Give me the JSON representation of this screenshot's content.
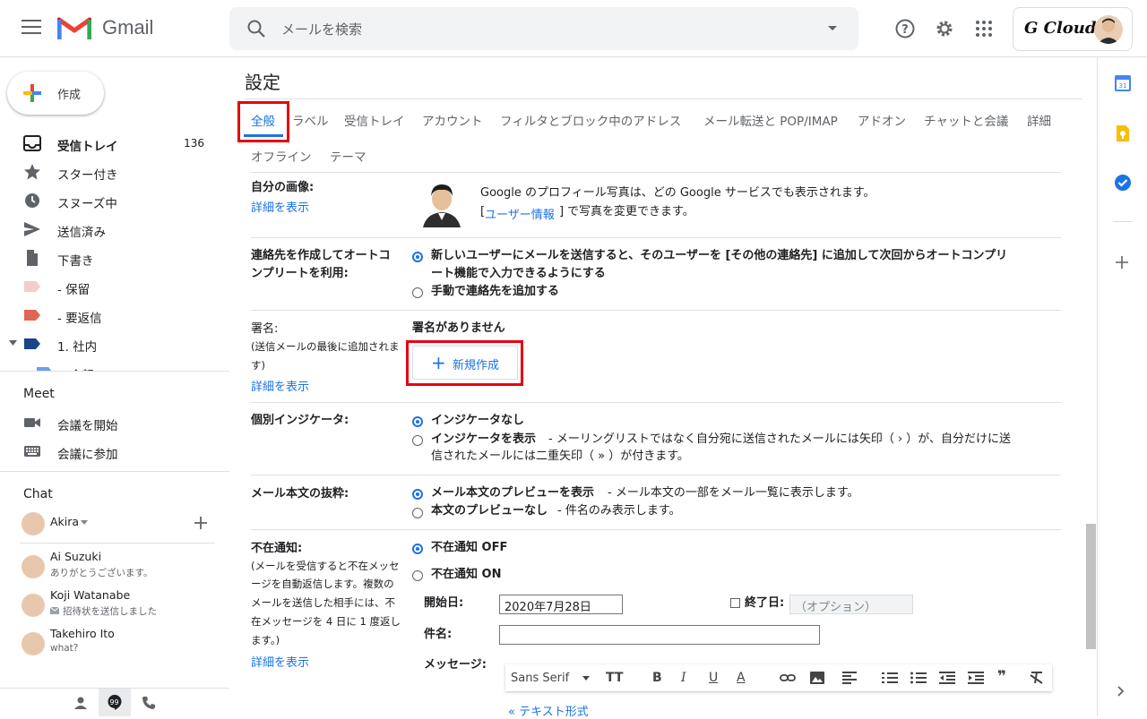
{
  "header": {
    "app_name": "Gmail",
    "search_placeholder": "メールを検索",
    "account_brand": "G Cloud"
  },
  "sidebar": {
    "compose_label": "作成",
    "items": [
      {
        "label": "受信トレイ",
        "count": "136"
      },
      {
        "label": "スター付き"
      },
      {
        "label": "スヌーズ中"
      },
      {
        "label": "送信済み"
      },
      {
        "label": "下書き"
      },
      {
        "label": "- 保留"
      },
      {
        "label": "- 要返信"
      },
      {
        "label": "1. 社内"
      },
      {
        "label": "会報"
      }
    ],
    "label_colors": [
      "#f4cccc",
      "#e06655",
      "#1c4587",
      "#6d9eeb"
    ],
    "meet_title": "Meet",
    "meet_items": [
      "会議を開始",
      "会議に参加"
    ],
    "chat_title": "Chat",
    "chat_self": "Akira",
    "chats": [
      {
        "name": "Ai Suzuki",
        "status": "ありがとうございます。"
      },
      {
        "name": "Koji Watanabe",
        "status": "招待状を送信しました"
      },
      {
        "name": "Takehiro Ito",
        "status": "what?"
      }
    ]
  },
  "settings": {
    "title": "設定",
    "tabs": [
      "全般",
      "ラベル",
      "受信トレイ",
      "アカウント",
      "フィルタとブロック中のアドレス",
      "メール転送と POP/IMAP",
      "アドオン",
      "チャットと会議",
      "詳細",
      "オフライン",
      "テーマ"
    ],
    "my_picture": {
      "label": "自分の画像:",
      "link": "詳細を表示",
      "desc1": "Google のプロフィール写真は、どの Google サービスでも表示されます。",
      "desc2_link": "ユーザー情報",
      "desc2_rest": "で写真を変更できます。",
      "bracket_open": "[",
      "bracket_close": "]"
    },
    "autocomplete": {
      "label1": "連絡先を作成してオートコ",
      "label2": "ンプリートを利用:",
      "opt1_line1": "新しいユーザーにメールを送信すると、そのユーザーを [その他の連絡先] に追加して次回からオートコンプリ",
      "opt1_line2": "ート機能で入力できるようにする",
      "opt2": "手動で連絡先を追加する"
    },
    "signature": {
      "label": "署名:",
      "sub1": "(送信メールの最後に追加されま",
      "sub2": "す)",
      "link": "詳細を表示",
      "none": "署名がありません",
      "new_button": "新規作成"
    },
    "indicators": {
      "label": "個別インジケータ:",
      "opt1": "インジケータなし",
      "opt2_bold": "インジケータを表示",
      "opt2_rest": " - メーリングリストではなく自分宛に送信されたメールには矢印（ › ）が、自分だけに送",
      "opt2_line2": "信されたメールには二重矢印（ » ）が付きます。"
    },
    "snippets": {
      "label": "メール本文の抜粋:",
      "opt1_bold": "メール本文のプレビューを表示",
      "opt1_rest": " - メール本文の一部をメール一覧に表示します。",
      "opt2_bold": "本文のプレビューなし",
      "opt2_rest": " - 件名のみ表示します。"
    },
    "vacation": {
      "label": "不在通知:",
      "sub": [
        "(メールを受信すると不在メッセ",
        "ージを自動返信します。複数の",
        "メールを送信した相手には、不",
        "在メッセージを 4 日に 1 度返し",
        "ます。)"
      ],
      "link": "詳細を表示",
      "off": "不在通知 OFF",
      "on": "不在通知 ON",
      "start_label": "開始日:",
      "start_value": "2020年7月28日",
      "end_label": "終了日:",
      "end_placeholder": "（オプション）",
      "subject_label": "件名:",
      "message_label": "メッセージ:",
      "font": "Sans Serif",
      "plain_text": "« テキスト形式"
    }
  }
}
